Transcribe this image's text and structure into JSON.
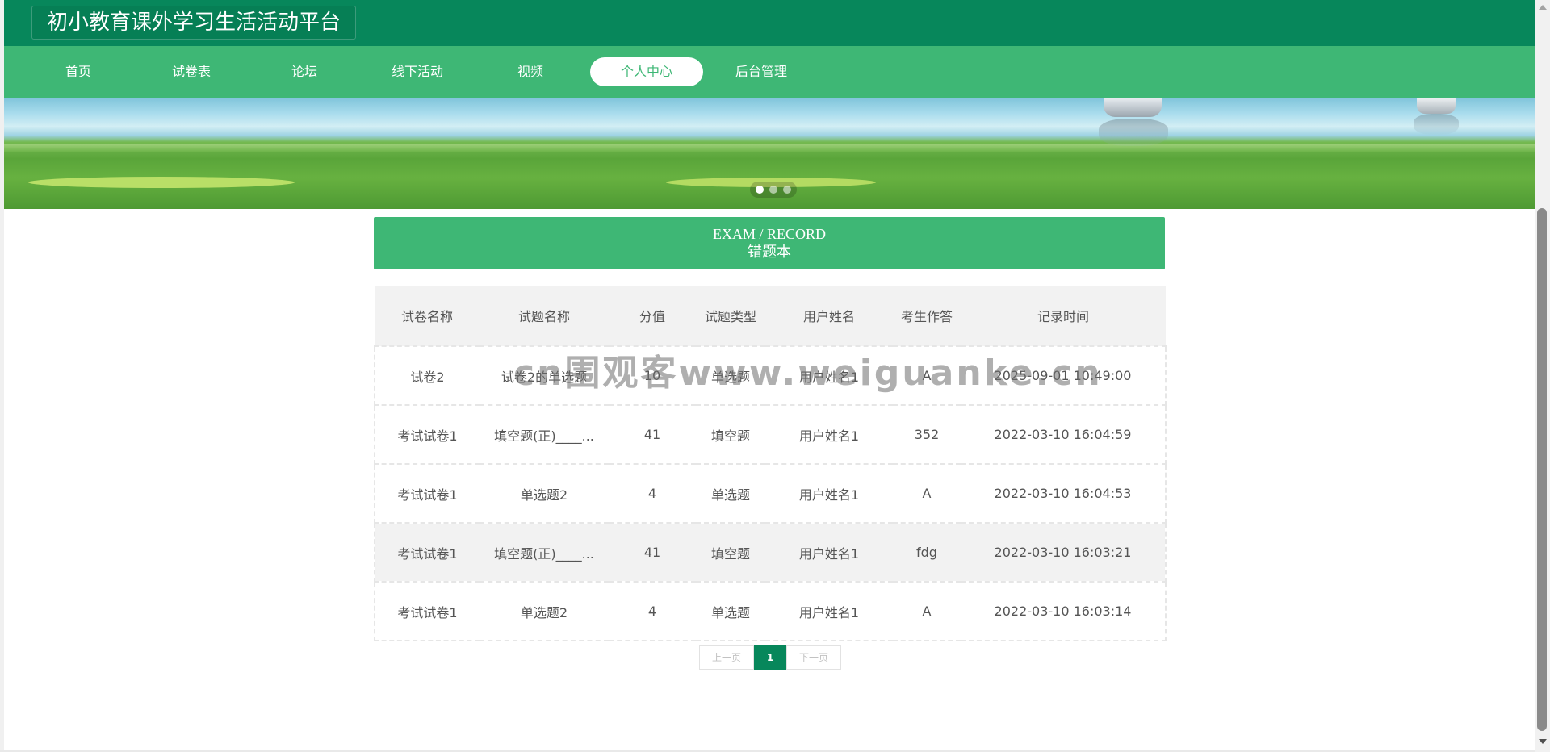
{
  "header": {
    "site_title": "初小教育课外学习生活活动平台"
  },
  "nav": {
    "items": [
      {
        "label": "首页",
        "active": false
      },
      {
        "label": "试卷表",
        "active": false
      },
      {
        "label": "论坛",
        "active": false
      },
      {
        "label": "线下活动",
        "active": false
      },
      {
        "label": "视频",
        "active": false
      },
      {
        "label": "个人中心",
        "active": true
      },
      {
        "label": "后台管理",
        "active": false
      }
    ]
  },
  "banner": {
    "slide_count": 3,
    "active_slide": 1
  },
  "section": {
    "title_en": "EXAM / RECORD",
    "title_cn": "错题本"
  },
  "table": {
    "columns": [
      "试卷名称",
      "试题名称",
      "分值",
      "试题类型",
      "用户姓名",
      "考生作答",
      "记录时间"
    ],
    "rows": [
      [
        "试卷2",
        "试卷2的单选题",
        "10",
        "单选题",
        "用户姓名1",
        "A",
        "2025-09-01 10:49:00"
      ],
      [
        "考试试卷1",
        "填空题(正)____...",
        "41",
        "填空题",
        "用户姓名1",
        "352",
        "2022-03-10 16:04:59"
      ],
      [
        "考试试卷1",
        "单选题2",
        "4",
        "单选题",
        "用户姓名1",
        "A",
        "2022-03-10 16:04:53"
      ],
      [
        "考试试卷1",
        "填空题(正)____...",
        "41",
        "填空题",
        "用户姓名1",
        "fdg",
        "2022-03-10 16:03:21"
      ],
      [
        "考试试卷1",
        "单选题2",
        "4",
        "单选题",
        "用户姓名1",
        "A",
        "2022-03-10 16:03:14"
      ]
    ]
  },
  "watermark": "cn围观客www.weiguanke.cn",
  "pagination": {
    "prev_label": "上一页",
    "current_page": "1",
    "next_label": "下一页"
  },
  "colors": {
    "header": "#07875b",
    "nav": "#3eb775",
    "accent": "#07875b"
  }
}
